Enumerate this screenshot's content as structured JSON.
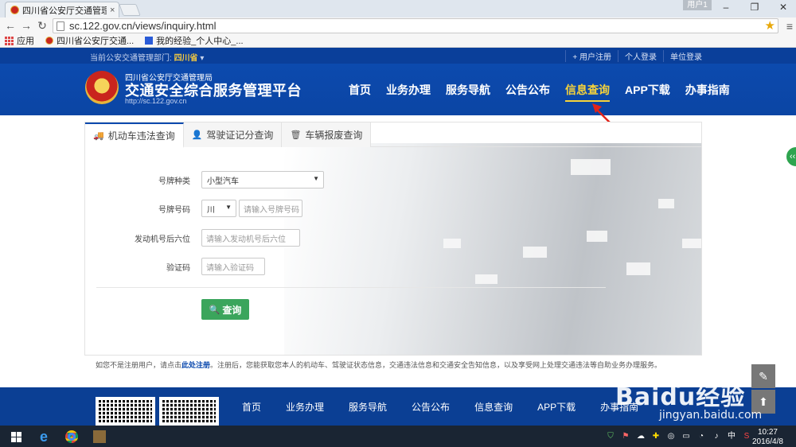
{
  "browser": {
    "tab_title": "四川省公安厅交通管理局",
    "tab_close": "×",
    "user_badge": "用户1",
    "url": "sc.122.gov.cn/views/inquiry.html",
    "bookmarks": [
      {
        "label": "应用"
      },
      {
        "label": "四川省公安厅交通..."
      },
      {
        "label": "我的经验_个人中心_..."
      }
    ]
  },
  "site": {
    "dept_prefix": "当前公安交通管理部门:",
    "dept_value": "四川省",
    "top_links": [
      "+ 用户注册",
      "个人登录",
      "单位登录"
    ],
    "org_name": "四川省公安厅交通管理局",
    "platform_title": "交通安全综合服务管理平台",
    "site_url": "http://sc.122.gov.cn",
    "nav": [
      "首页",
      "业务办理",
      "服务导航",
      "公告公布",
      "信息查询",
      "APP下载",
      "办事指南"
    ],
    "active_nav": "信息查询"
  },
  "query": {
    "tabs": [
      {
        "label": "机动车违法查询",
        "icon": "truck-icon"
      },
      {
        "label": "驾驶证记分查询",
        "icon": "person-icon"
      },
      {
        "label": "车辆报废查询",
        "icon": "trash-icon"
      }
    ],
    "plate_type_label": "号牌种类",
    "plate_type_value": "小型汽车",
    "plate_no_label": "号牌号码",
    "plate_prefix_value": "川",
    "plate_no_placeholder": "请输入号牌号码",
    "engine_label": "发动机号后六位",
    "engine_placeholder": "请输入发动机号后六位",
    "captcha_label": "验证码",
    "captcha_placeholder": "请输入验证码",
    "submit_label": "查询"
  },
  "notice": {
    "prefix": "如您不是注册用户，请点击",
    "link": "此处注册",
    "suffix": "。注册后，您能获取您本人的机动车、驾驶证状态信息，交通违法信息和交通安全告知信息，以及享受网上处理交通违法等自助业务办理服务。"
  },
  "footer": {
    "nav": [
      "首页",
      "业务办理",
      "服务导航",
      "公告公布",
      "信息查询",
      "APP下载",
      "办事指南"
    ]
  },
  "watermark": {
    "text": "Baidu经验",
    "url": "jingyan.baidu.com"
  },
  "taskbar": {
    "ime": "中",
    "time": "10:27",
    "date": "2016/4/8"
  }
}
